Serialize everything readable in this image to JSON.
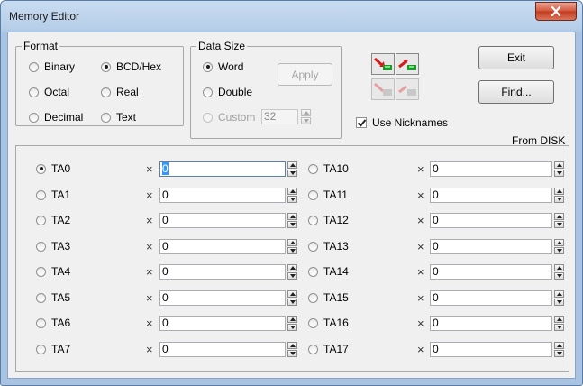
{
  "window": {
    "title": "Memory Editor"
  },
  "format": {
    "legend": "Format",
    "options": [
      {
        "label": "Binary",
        "checked": false
      },
      {
        "label": "BCD/Hex",
        "checked": true
      },
      {
        "label": "Octal",
        "checked": false
      },
      {
        "label": "Real",
        "checked": false
      },
      {
        "label": "Decimal",
        "checked": false
      },
      {
        "label": "Text",
        "checked": false
      }
    ]
  },
  "data_size": {
    "legend": "Data Size",
    "word": "Word",
    "double": "Double",
    "custom": "Custom",
    "custom_value": "32",
    "apply": "Apply"
  },
  "buttons": {
    "exit": "Exit",
    "find": "Find..."
  },
  "nicknames": {
    "label": "Use Nicknames",
    "checked": true
  },
  "source": "From DISK",
  "registers_left": [
    {
      "name": "TA0",
      "value": "0",
      "checked": true
    },
    {
      "name": "TA1",
      "value": "0",
      "checked": false
    },
    {
      "name": "TA2",
      "value": "0",
      "checked": false
    },
    {
      "name": "TA3",
      "value": "0",
      "checked": false
    },
    {
      "name": "TA4",
      "value": "0",
      "checked": false
    },
    {
      "name": "TA5",
      "value": "0",
      "checked": false
    },
    {
      "name": "TA6",
      "value": "0",
      "checked": false
    },
    {
      "name": "TA7",
      "value": "0",
      "checked": false
    }
  ],
  "registers_right": [
    {
      "name": "TA10",
      "value": "0",
      "checked": false
    },
    {
      "name": "TA11",
      "value": "0",
      "checked": false
    },
    {
      "name": "TA12",
      "value": "0",
      "checked": false
    },
    {
      "name": "TA13",
      "value": "0",
      "checked": false
    },
    {
      "name": "TA14",
      "value": "0",
      "checked": false
    },
    {
      "name": "TA15",
      "value": "0",
      "checked": false
    },
    {
      "name": "TA16",
      "value": "0",
      "checked": false
    },
    {
      "name": "TA17",
      "value": "0",
      "checked": false
    }
  ],
  "multiply_symbol": "×",
  "colors": {
    "title_bg": "#b9d1ea",
    "selection": "#3399ff",
    "close": "#c7391c"
  }
}
